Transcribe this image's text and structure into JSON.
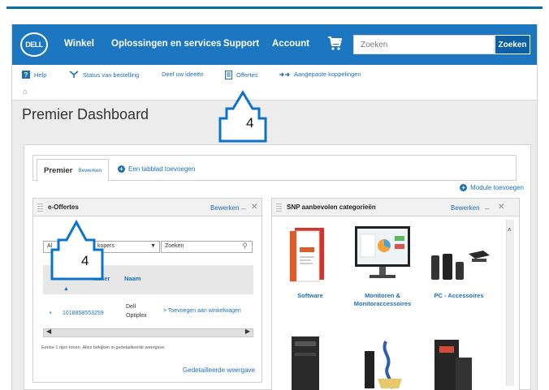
{
  "navbar": {
    "logo": "DELL",
    "links": [
      "Winkel",
      "Oplossingen en services",
      "Support",
      "Account"
    ],
    "search_placeholder": "Zoeken",
    "search_button": "Zoeken"
  },
  "subnav": {
    "items": [
      "Help",
      "Status van bestelling",
      "Deel uw ideeën",
      "Offertes",
      "Aangepaste koppelingen"
    ],
    "help_glyph": "?"
  },
  "page_title": "Premier Dashboard",
  "tabs": {
    "active_label": "Premier",
    "active_edit": "Bewerken",
    "add_tab": "Een tabblad toevoegen"
  },
  "module_add": "Module toevoegen",
  "eoffertes": {
    "title": "e-Offertes",
    "edit": "Bewerken",
    "min": "_",
    "close": "✕",
    "select_value": "Al",
    "select_value_tail": "kopers",
    "search_value": "Zoeken",
    "col_number": "mmer",
    "col_name": "Naam",
    "row": {
      "number": "1018858553259",
      "name_line1": "Dell",
      "name_line2": "Optiplex",
      "action": "> Toevoegen aan winkelwagen"
    },
    "info": "Eerste 1 rijen tonen. Alles bekijken in gedetailleerde weergave.",
    "detail_link": "Gedetailleerde weergave"
  },
  "snp": {
    "title": "SNP aanbevolen categorieën",
    "edit": "Bewerken",
    "min": "_",
    "close": "✕",
    "categories": [
      "Software",
      "Monitoren &",
      "Monitoraccessoires",
      "PC - Accessoires"
    ]
  },
  "callouts": [
    "4",
    "4"
  ],
  "colors": {
    "brand_blue": "#1c76c0",
    "link_blue": "#1d6fb8",
    "callout_blue": "#0d73c8"
  }
}
